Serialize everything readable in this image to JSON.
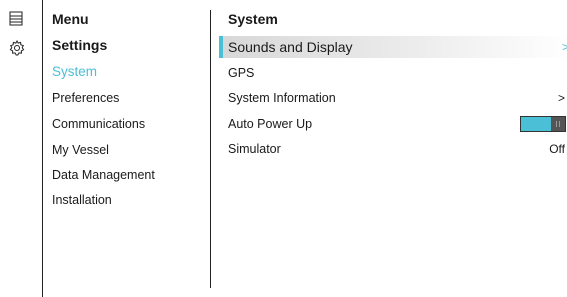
{
  "colors": {
    "accent": "#4bbfd6",
    "selected_bg": "#d8d8d8",
    "toggle_knob": "#555555"
  },
  "rail": {
    "icons": [
      "menu-icon",
      "gear-icon"
    ]
  },
  "left": {
    "menu_title": "Menu",
    "settings_title": "Settings",
    "items": [
      {
        "label": "System",
        "active": true
      },
      {
        "label": "Preferences"
      },
      {
        "label": "Communications"
      },
      {
        "label": "My Vessel"
      },
      {
        "label": "Data Management"
      },
      {
        "label": "Installation"
      }
    ]
  },
  "right": {
    "title": "System",
    "rows": [
      {
        "label": "Sounds and Display",
        "trail": ">",
        "selected": true
      },
      {
        "label": "GPS",
        "trail": ""
      },
      {
        "label": "System Information",
        "trail": ">"
      },
      {
        "label": "Auto Power Up",
        "toggle": "on"
      },
      {
        "label": "Simulator",
        "trail": "Off"
      }
    ]
  }
}
